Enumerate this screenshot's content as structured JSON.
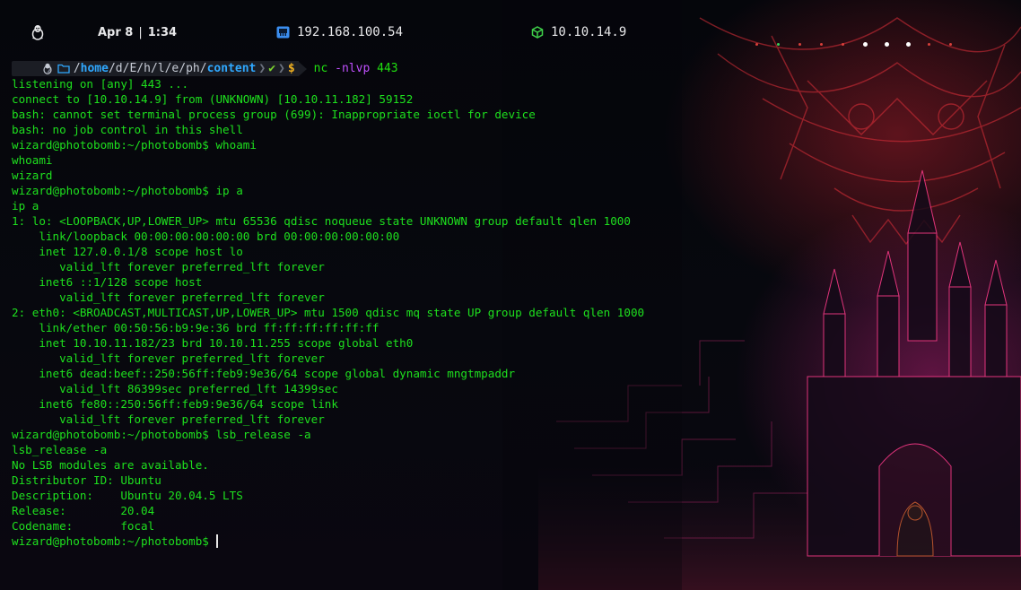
{
  "topbar": {
    "date": "Apr 8",
    "separator": "|",
    "time": "1:34",
    "local_ip": "192.168.100.54",
    "vpn_ip": "10.10.14.9",
    "icons": [
      "linux-tux-icon",
      "ethernet-icon",
      "vpn-cube-icon"
    ],
    "workspace_dot_colors": [
      "#d8403a",
      "#3ad05a",
      "#d8403a",
      "#d8403a",
      "#d8403a",
      "#ffffff",
      "#ffffff",
      "#ffffff",
      "#d8403a",
      "#d8403a"
    ]
  },
  "prompt": {
    "path_sep": "/",
    "path": [
      "home",
      "d",
      "E",
      "h",
      "l",
      "e",
      "ph",
      "content"
    ],
    "status": "✔",
    "symbol": "$",
    "command": "nc",
    "command_flag": "-nlvp",
    "command_arg": "443"
  },
  "terminal": {
    "lines": [
      "listening on [any] 443 ...",
      "connect to [10.10.14.9] from (UNKNOWN) [10.10.11.182] 59152",
      "bash: cannot set terminal process group (699): Inappropriate ioctl for device",
      "bash: no job control in this shell",
      "wizard@photobomb:~/photobomb$ whoami",
      "whoami",
      "wizard",
      "wizard@photobomb:~/photobomb$ ip a",
      "ip a",
      "1: lo: <LOOPBACK,UP,LOWER_UP> mtu 65536 qdisc noqueue state UNKNOWN group default qlen 1000",
      "    link/loopback 00:00:00:00:00:00 brd 00:00:00:00:00:00",
      "    inet 127.0.0.1/8 scope host lo",
      "       valid_lft forever preferred_lft forever",
      "    inet6 ::1/128 scope host",
      "       valid_lft forever preferred_lft forever",
      "2: eth0: <BROADCAST,MULTICAST,UP,LOWER_UP> mtu 1500 qdisc mq state UP group default qlen 1000",
      "    link/ether 00:50:56:b9:9e:36 brd ff:ff:ff:ff:ff:ff",
      "    inet 10.10.11.182/23 brd 10.10.11.255 scope global eth0",
      "       valid_lft forever preferred_lft forever",
      "    inet6 dead:beef::250:56ff:feb9:9e36/64 scope global dynamic mngtmpaddr",
      "       valid_lft 86399sec preferred_lft 14399sec",
      "    inet6 fe80::250:56ff:feb9:9e36/64 scope link",
      "       valid_lft forever preferred_lft forever",
      "wizard@photobomb:~/photobomb$ lsb_release -a",
      "lsb_release -a",
      "No LSB modules are available.",
      "Distributor ID:\tUbuntu",
      "Description:\tUbuntu 20.04.5 LTS",
      "Release:\t20.04",
      "Codename:\tfocal"
    ],
    "current_prompt": "wizard@photobomb:~/photobomb$ ",
    "text_color": "#1ee01e"
  }
}
